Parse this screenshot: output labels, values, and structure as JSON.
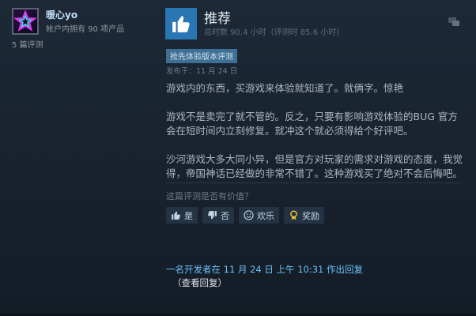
{
  "author": {
    "name": "暖心yo",
    "games_owned": "帐户内拥有 90 项产品",
    "review_count": "5 篇评测"
  },
  "review": {
    "verdict": "推荐",
    "playtime": "总时数 90.4 小时（评测时 85.6 小时）",
    "early_access_tag": "抢先体验版本评测",
    "posted": "发布于：11 月 24 日",
    "paragraphs": [
      "游戏内的东西，买游戏来体验就知道了。就俩字。惊艳",
      "游戏不是卖完了就不管的。反之，只要有影响游戏体验的BUG 官方会在短时间内立刻修复。就冲这个就必须得给个好评吧。",
      "沙河游戏大多大同小异，但是官方对玩家的需求对游戏的态度，我觉得，帝国神话已经做的非常不错了。这种游戏买了绝对不会后悔吧。"
    ]
  },
  "feedback": {
    "question": "这篇评测是否有价值？",
    "yes_label": "是",
    "no_label": "否",
    "funny_label": "欢乐",
    "award_label": "奖励"
  },
  "developer_reply": {
    "text": "一名开发者在 11 月 24 日 上午 10:31 作出回复",
    "view_label": "（查看回复）"
  },
  "icons": {
    "thumb": "thumbs-up-icon",
    "corner": "translate-icon",
    "vote_yes": "thumbs-up-icon",
    "vote_no": "thumbs-down-icon",
    "funny": "smile-icon",
    "award": "award-icon"
  },
  "colors": {
    "accent_blue": "#2a75b3",
    "link_blue": "#67c1f5",
    "tag_bg": "#3e6f94"
  }
}
